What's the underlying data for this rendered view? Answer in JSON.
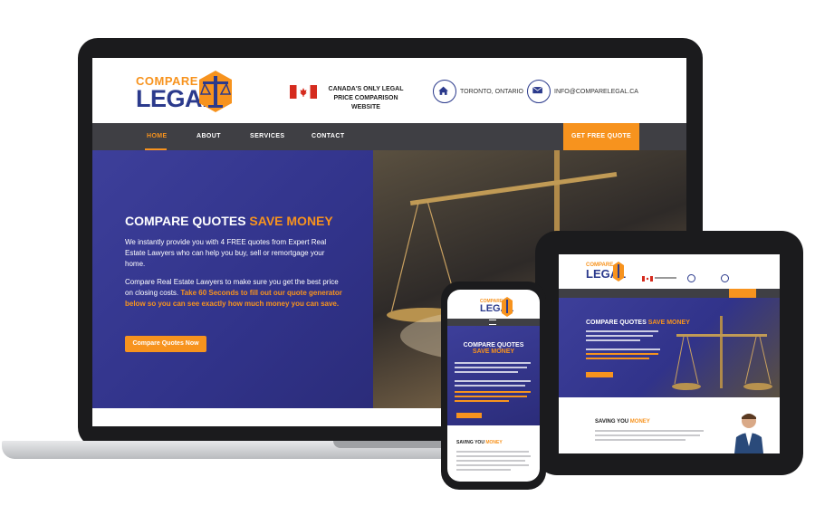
{
  "header": {
    "logo_top": "COMPARE",
    "logo_bottom": "LEGAL",
    "tagline": "CANADA'S ONLY LEGAL PRICE COMPARISON WEBSITE",
    "location": "TORONTO, ONTARIO",
    "email": "INFO@COMPARELEGAL.CA"
  },
  "nav": {
    "items": [
      "HOME",
      "ABOUT",
      "SERVICES",
      "CONTACT"
    ],
    "cta": "GET FREE QUOTE"
  },
  "hero": {
    "title_part1": "COMPARE QUOTES ",
    "title_part2": "SAVE MONEY",
    "paragraph1": "We instantly provide you with 4 FREE quotes from Expert Real Estate Lawyers who can help you buy, sell or remortgage your home.",
    "paragraph2_plain": "Compare Real Estate Lawyers to make sure you get the best price on closing costs. ",
    "paragraph2_accent": "Take 60 Seconds to fill out our quote generator below so you can see exactly how much money you can save.",
    "button": "Compare Quotes Now"
  },
  "tablet": {
    "logo_top": "COMPARE",
    "logo_bottom": "LEGAL",
    "title_part1": "COMPARE QUOTES ",
    "title_part2": "SAVE MONEY",
    "saving_part1": "SAVING YOU ",
    "saving_part2": "MONEY"
  },
  "phone": {
    "logo_top": "COMPARE",
    "logo_bottom": "LEGAL",
    "title_part1": "COMPARE QUOTES ",
    "title_part2": "SAVE MONEY",
    "saving_part1": "SAVING YOU ",
    "saving_part2": "MONEY"
  },
  "colors": {
    "brand_orange": "#f7931e",
    "brand_blue": "#2b3a8c",
    "nav_dark": "#3f3f44",
    "hero_purple": "#31338a"
  },
  "icons": [
    "canada-flag-icon",
    "home-icon",
    "mail-icon",
    "scales-of-justice-icon"
  ]
}
